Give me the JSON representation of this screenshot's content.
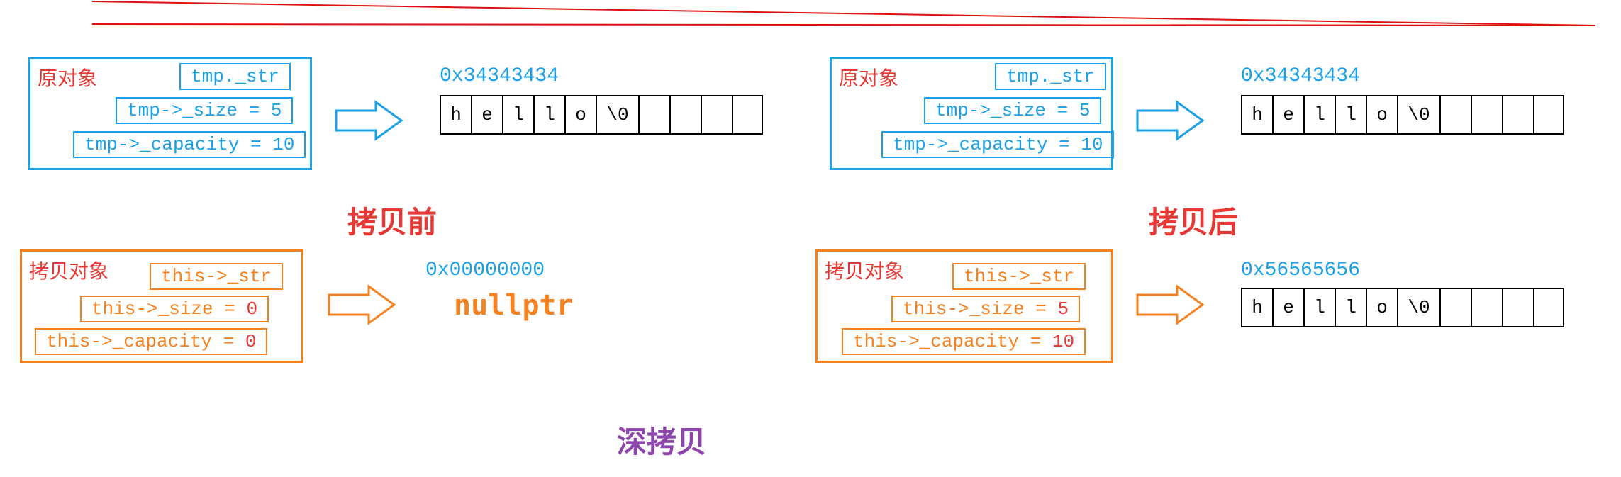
{
  "decor": {
    "red_line": true
  },
  "before": {
    "label": "拷贝前",
    "source": {
      "title": "原对象",
      "fields": {
        "str": "tmp._str",
        "size": "tmp->_size = 5",
        "capacity": "tmp->_capacity = 10"
      },
      "addr": "0x34343434",
      "mem": [
        "h",
        "e",
        "l",
        "l",
        "o",
        "\\0",
        "",
        "",
        "",
        ""
      ]
    },
    "copy": {
      "title": "拷贝对象",
      "fields": {
        "str": "this->_str",
        "size_label": "this->_size = ",
        "size_val": "0",
        "capacity_label": "this->_capacity = ",
        "capacity_val": "0"
      },
      "addr": "0x00000000",
      "null_text": "nullptr"
    }
  },
  "after": {
    "label": "拷贝后",
    "source": {
      "title": "原对象",
      "fields": {
        "str": "tmp._str",
        "size": "tmp->_size = 5",
        "capacity": "tmp->_capacity = 10"
      },
      "addr": "0x34343434",
      "mem": [
        "h",
        "e",
        "l",
        "l",
        "o",
        "\\0",
        "",
        "",
        "",
        ""
      ]
    },
    "copy": {
      "title": "拷贝对象",
      "fields": {
        "str": "this->_str",
        "size_label": "this->_size = ",
        "size_val": "5",
        "capacity_label": "this->_capacity = ",
        "capacity_val": "10"
      },
      "addr": "0x56565656",
      "mem": [
        "h",
        "e",
        "l",
        "l",
        "o",
        "\\0",
        "",
        "",
        "",
        ""
      ]
    }
  },
  "footer": {
    "title": "深拷贝"
  }
}
